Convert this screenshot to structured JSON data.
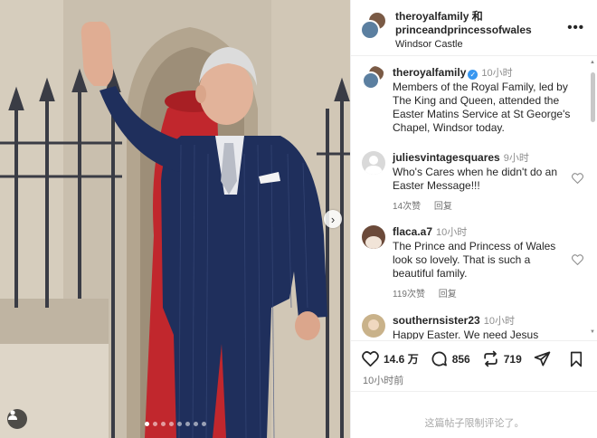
{
  "post": {
    "author": "theroyalfamily",
    "connector": " 和",
    "coauthor": "princeandprincessofwales",
    "location": "Windsor Castle",
    "more_icon": "more-horizontal-icon"
  },
  "caption": {
    "user": "theroyalfamily",
    "verified": true,
    "time": "10小时",
    "text": "Members of the Royal Family, led by The King and Queen, attended the Easter Matins Service at St George's Chapel, Windsor today."
  },
  "comments": [
    {
      "user": "juliesvintagesquares",
      "time": "9小时",
      "text": "Who's Cares when he didn't do an Easter Message!!!",
      "likes": "14次赞",
      "reply": "回复"
    },
    {
      "user": "flaca.a7",
      "time": "10小时",
      "text": "The Prince and Princess of Wales look so lovely. That is such a beautiful family.",
      "likes": "119次赞",
      "reply": "回复"
    },
    {
      "user": "southernsister23",
      "time": "10小时",
      "text": "Happy Easter. We need Jesus"
    }
  ],
  "actions": {
    "likes": "14.6 万",
    "comments": "856",
    "reposts": "719",
    "posted": "10小时前"
  },
  "footer": {
    "notice": "这篇帖子限制评论了。"
  },
  "carousel": {
    "total": 8,
    "active": 1
  },
  "colors": {
    "verified": "#3897f0",
    "suit": "#1f2f5c",
    "red_coat": "#c1272d"
  }
}
